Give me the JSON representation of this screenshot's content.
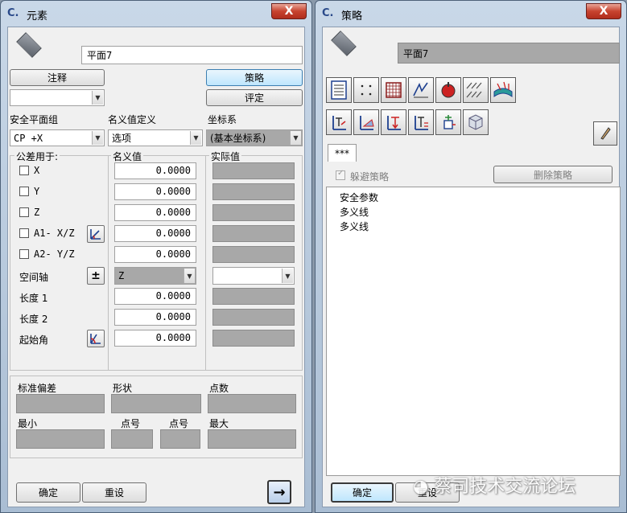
{
  "left_window": {
    "title": "元素",
    "close_label": "X",
    "name_value": "平面7",
    "annotation_button": "注释",
    "strategy_button": "策略",
    "evaluate_button": "评定",
    "annotation_select": "",
    "safety_plane_label": "安全平面组",
    "nominal_def_label": "名义值定义",
    "coord_label": "坐标系",
    "safety_plane_value": "CP +X",
    "nominal_def_value": "选项",
    "coord_value": "(基本坐标系)",
    "tolerance_for_label": "公差用于:",
    "nominal_col_label": "名义值",
    "actual_col_label": "实际值",
    "rows": [
      {
        "label": "X",
        "checkbox": true,
        "nominal": "0.0000"
      },
      {
        "label": "Y",
        "checkbox": true,
        "nominal": "0.0000"
      },
      {
        "label": "Z",
        "checkbox": true,
        "nominal": "0.0000"
      },
      {
        "label": "A1- X/Z",
        "checkbox": true,
        "nominal": "0.0000"
      },
      {
        "label": "A2- Y/Z",
        "checkbox": true,
        "nominal": "0.0000"
      },
      {
        "label": "空间轴",
        "checkbox": false,
        "nominal": "Z"
      },
      {
        "label": "长度 1",
        "checkbox": false,
        "nominal": "0.0000"
      },
      {
        "label": "长度 2",
        "checkbox": false,
        "nominal": "0.0000"
      },
      {
        "label": "起始角",
        "checkbox": false,
        "nominal": "0.0000"
      }
    ],
    "plusminus": "±",
    "stats": {
      "std_dev": "标准偏差",
      "shape": "形状",
      "points": "点数",
      "min": "最小",
      "point_no_1": "点号",
      "point_no_2": "点号",
      "max": "最大"
    },
    "ok_button": "确定",
    "reset_button": "重设",
    "arrow": "→"
  },
  "right_window": {
    "title": "策略",
    "close_label": "X",
    "name_value": "平面7",
    "tab_label": "***",
    "avoid_strategy_label": "躲避策略",
    "delete_strategy_button": "删除策略",
    "strategy_items": [
      "安全参数",
      "多义线",
      "多义线"
    ],
    "ok_button": "确定",
    "reset_button": "重设"
  },
  "watermark": "蔡司技术交流论坛",
  "colors": {
    "title_gradient_top": "#c9d8e8",
    "close_red": "#c7432f",
    "disabled_grey": "#a8a8a8"
  }
}
